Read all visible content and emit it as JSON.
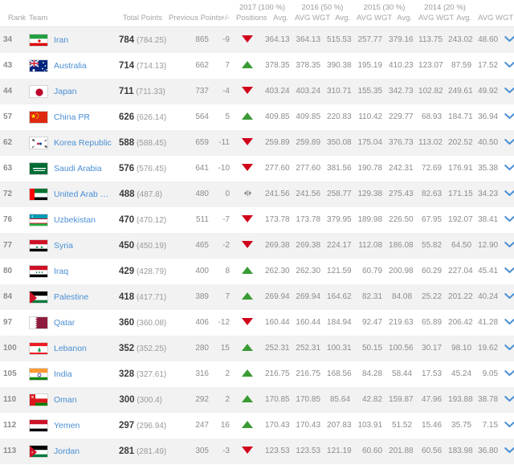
{
  "header": {
    "groups": [
      {
        "label": "",
        "span": 5
      },
      {
        "label": "2017 (100 %)",
        "span": 2
      },
      {
        "label": "2016 (50 %)",
        "span": 2
      },
      {
        "label": "2015 (30 %)",
        "span": 2
      },
      {
        "label": "2014 (20 %)",
        "span": 2
      },
      {
        "label": "",
        "span": 1
      }
    ],
    "columns": [
      "Rank",
      "Team",
      "Total Points",
      "Previous Points",
      "+/-",
      "Positions",
      "Avg.",
      "AVG WGT",
      "Avg.",
      "AVG WGT",
      "Avg.",
      "AVG WGT",
      "Avg.",
      "AVG WGT",
      ""
    ]
  },
  "icons": {
    "expand": "chevron-down-icon",
    "up": "arrow-up-icon",
    "down": "arrow-down-icon",
    "same": "arrow-same-icon"
  },
  "colors": {
    "up": "#3a9b35",
    "down": "#d0021b",
    "same": "#9a9a9a",
    "link": "#4a8fd4",
    "chevron": "#4a8fd4",
    "row_alt": "#f2f2f2"
  },
  "rows": [
    {
      "rank": "34",
      "team": "Iran",
      "flag": "iran-flag",
      "total_points": "784",
      "total_points_exact": "(784.25)",
      "previous_points": "865",
      "change": "-9",
      "direction": "down",
      "avg_2017": "364.13",
      "wgt_2017": "364.13",
      "avg_2016": "515.53",
      "wgt_2016": "257.77",
      "avg_2015": "379.16",
      "wgt_2015": "113.75",
      "avg_2014": "243.02",
      "wgt_2014": "48.60"
    },
    {
      "rank": "43",
      "team": "Australia",
      "flag": "australia-flag",
      "total_points": "714",
      "total_points_exact": "(714.13)",
      "previous_points": "662",
      "change": "7",
      "direction": "up",
      "avg_2017": "378.35",
      "wgt_2017": "378.35",
      "avg_2016": "390.38",
      "wgt_2016": "195.19",
      "avg_2015": "410.23",
      "wgt_2015": "123.07",
      "avg_2014": "87.59",
      "wgt_2014": "17.52"
    },
    {
      "rank": "44",
      "team": "Japan",
      "flag": "japan-flag",
      "total_points": "711",
      "total_points_exact": "(711.33)",
      "previous_points": "737",
      "change": "-4",
      "direction": "down",
      "avg_2017": "403.24",
      "wgt_2017": "403.24",
      "avg_2016": "310.71",
      "wgt_2016": "155.35",
      "avg_2015": "342.73",
      "wgt_2015": "102.82",
      "avg_2014": "249.61",
      "wgt_2014": "49.92"
    },
    {
      "rank": "57",
      "team": "China PR",
      "flag": "china-flag",
      "total_points": "626",
      "total_points_exact": "(626.14)",
      "previous_points": "564",
      "change": "5",
      "direction": "up",
      "avg_2017": "409.85",
      "wgt_2017": "409.85",
      "avg_2016": "220.83",
      "wgt_2016": "110.42",
      "avg_2015": "229.77",
      "wgt_2015": "68.93",
      "avg_2014": "184.71",
      "wgt_2014": "36.94"
    },
    {
      "rank": "62",
      "team": "Korea Republic",
      "flag": "korea-flag",
      "total_points": "588",
      "total_points_exact": "(588.45)",
      "previous_points": "659",
      "change": "-11",
      "direction": "down",
      "avg_2017": "259.89",
      "wgt_2017": "259.89",
      "avg_2016": "350.08",
      "wgt_2016": "175.04",
      "avg_2015": "376.73",
      "wgt_2015": "113.02",
      "avg_2014": "202.52",
      "wgt_2014": "40.50"
    },
    {
      "rank": "63",
      "team": "Saudi Arabia",
      "flag": "saudi-arabia-flag",
      "total_points": "576",
      "total_points_exact": "(576.45)",
      "previous_points": "641",
      "change": "-10",
      "direction": "down",
      "avg_2017": "277.60",
      "wgt_2017": "277.60",
      "avg_2016": "381.56",
      "wgt_2016": "190.78",
      "avg_2015": "242.31",
      "wgt_2015": "72.69",
      "avg_2014": "176.91",
      "wgt_2014": "35.38"
    },
    {
      "rank": "72",
      "team": "United Arab Emirates",
      "flag": "uae-flag",
      "total_points": "488",
      "total_points_exact": "(487.8)",
      "previous_points": "480",
      "change": "0",
      "direction": "same",
      "avg_2017": "241.56",
      "wgt_2017": "241.56",
      "avg_2016": "258.77",
      "wgt_2016": "129.38",
      "avg_2015": "275.43",
      "wgt_2015": "82.63",
      "avg_2014": "171.15",
      "wgt_2014": "34.23"
    },
    {
      "rank": "76",
      "team": "Uzbekistan",
      "flag": "uzbekistan-flag",
      "total_points": "470",
      "total_points_exact": "(470.12)",
      "previous_points": "511",
      "change": "-7",
      "direction": "down",
      "avg_2017": "173.78",
      "wgt_2017": "173.78",
      "avg_2016": "379.95",
      "wgt_2016": "189.98",
      "avg_2015": "226.50",
      "wgt_2015": "67.95",
      "avg_2014": "192.07",
      "wgt_2014": "38.41"
    },
    {
      "rank": "77",
      "team": "Syria",
      "flag": "syria-flag",
      "total_points": "450",
      "total_points_exact": "(450.19)",
      "previous_points": "465",
      "change": "-2",
      "direction": "down",
      "avg_2017": "269.38",
      "wgt_2017": "269.38",
      "avg_2016": "224.17",
      "wgt_2016": "112.08",
      "avg_2015": "186.08",
      "wgt_2015": "55.82",
      "avg_2014": "64.50",
      "wgt_2014": "12.90"
    },
    {
      "rank": "80",
      "team": "Iraq",
      "flag": "iraq-flag",
      "total_points": "429",
      "total_points_exact": "(428.79)",
      "previous_points": "400",
      "change": "8",
      "direction": "up",
      "avg_2017": "262.30",
      "wgt_2017": "262.30",
      "avg_2016": "121.59",
      "wgt_2016": "60.79",
      "avg_2015": "200.98",
      "wgt_2015": "60.29",
      "avg_2014": "227.04",
      "wgt_2014": "45.41"
    },
    {
      "rank": "84",
      "team": "Palestine",
      "flag": "palestine-flag",
      "total_points": "418",
      "total_points_exact": "(417.71)",
      "previous_points": "389",
      "change": "7",
      "direction": "up",
      "avg_2017": "269.94",
      "wgt_2017": "269.94",
      "avg_2016": "164.62",
      "wgt_2016": "82.31",
      "avg_2015": "84.08",
      "wgt_2015": "25.22",
      "avg_2014": "201.22",
      "wgt_2014": "40.24"
    },
    {
      "rank": "97",
      "team": "Qatar",
      "flag": "qatar-flag",
      "total_points": "360",
      "total_points_exact": "(360.08)",
      "previous_points": "406",
      "change": "-12",
      "direction": "down",
      "avg_2017": "160.44",
      "wgt_2017": "160.44",
      "avg_2016": "184.94",
      "wgt_2016": "92.47",
      "avg_2015": "219.63",
      "wgt_2015": "65.89",
      "avg_2014": "206.42",
      "wgt_2014": "41.28"
    },
    {
      "rank": "100",
      "team": "Lebanon",
      "flag": "lebanon-flag",
      "total_points": "352",
      "total_points_exact": "(352.25)",
      "previous_points": "280",
      "change": "15",
      "direction": "up",
      "avg_2017": "252.31",
      "wgt_2017": "252.31",
      "avg_2016": "100.31",
      "wgt_2016": "50.15",
      "avg_2015": "100.56",
      "wgt_2015": "30.17",
      "avg_2014": "98.10",
      "wgt_2014": "19.62"
    },
    {
      "rank": "105",
      "team": "India",
      "flag": "india-flag",
      "total_points": "328",
      "total_points_exact": "(327.61)",
      "previous_points": "316",
      "change": "2",
      "direction": "up",
      "avg_2017": "216.75",
      "wgt_2017": "216.75",
      "avg_2016": "168.56",
      "wgt_2016": "84.28",
      "avg_2015": "58.44",
      "wgt_2015": "17.53",
      "avg_2014": "45.24",
      "wgt_2014": "9.05"
    },
    {
      "rank": "110",
      "team": "Oman",
      "flag": "oman-flag",
      "total_points": "300",
      "total_points_exact": "(300.4)",
      "previous_points": "292",
      "change": "2",
      "direction": "up",
      "avg_2017": "170.85",
      "wgt_2017": "170.85",
      "avg_2016": "85.64",
      "wgt_2016": "42.82",
      "avg_2015": "159.87",
      "wgt_2015": "47.96",
      "avg_2014": "193.88",
      "wgt_2014": "38.78"
    },
    {
      "rank": "112",
      "team": "Yemen",
      "flag": "yemen-flag",
      "total_points": "297",
      "total_points_exact": "(296.94)",
      "previous_points": "247",
      "change": "16",
      "direction": "up",
      "avg_2017": "170.43",
      "wgt_2017": "170.43",
      "avg_2016": "207.83",
      "wgt_2016": "103.91",
      "avg_2015": "51.52",
      "wgt_2015": "15.46",
      "avg_2014": "35.75",
      "wgt_2014": "7.15"
    },
    {
      "rank": "113",
      "team": "Jordan",
      "flag": "jordan-flag",
      "total_points": "281",
      "total_points_exact": "(281.49)",
      "previous_points": "305",
      "change": "-3",
      "direction": "down",
      "avg_2017": "123.53",
      "wgt_2017": "123.53",
      "avg_2016": "121.19",
      "wgt_2016": "60.60",
      "avg_2015": "201.88",
      "wgt_2015": "60.56",
      "avg_2014": "183.98",
      "wgt_2014": "36.80"
    }
  ]
}
